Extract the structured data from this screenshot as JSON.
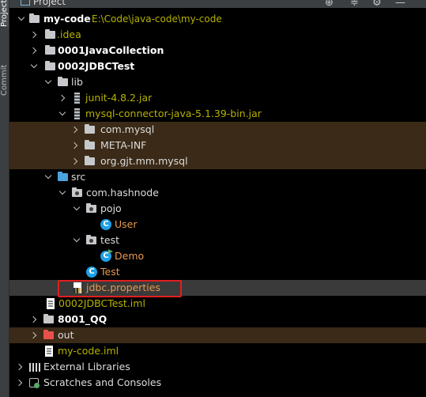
{
  "sidebar": {
    "project_tab": "Project",
    "commit_tab": "Commit"
  },
  "toolbar": {
    "title": "Project",
    "add_icon": "⊕",
    "collapse_icon": "≑",
    "gear_icon": "⚙",
    "minimize_icon": "—"
  },
  "tree": {
    "root": {
      "label": "my-code",
      "path": "E:\\Code\\java-code\\my-code"
    },
    "idea": "idea",
    "java_collection": "0001JavaCollection",
    "jdbc_test": "0002JDBCTest",
    "lib": "lib",
    "junit": "junit-4.8.2.jar",
    "mysql_jar": "mysql-connector-java-5.1.39-bin.jar",
    "com_mysql": "com.mysql",
    "meta_inf": "META-INF",
    "org_gjt": "org.gjt.mm.mysql",
    "src": "src",
    "com_hashnode": "com.hashnode",
    "pojo": "pojo",
    "user": "User",
    "test_pkg": "test",
    "demo": "Demo",
    "test_class": "Test",
    "jdbc_properties": "jdbc.properties",
    "jdbc_iml": "0002JDBCTest.iml",
    "qq": "8001_QQ",
    "out": "out",
    "my_code_iml": "my-code.iml",
    "external_libraries": "External Libraries",
    "scratches": "Scratches and Consoles"
  },
  "colors": {
    "background": "#000000",
    "highlight_row": "#3b2a17",
    "selection_box": "#e02020",
    "module_path": "#b5b100",
    "class_icon": "#1ea0e6"
  }
}
